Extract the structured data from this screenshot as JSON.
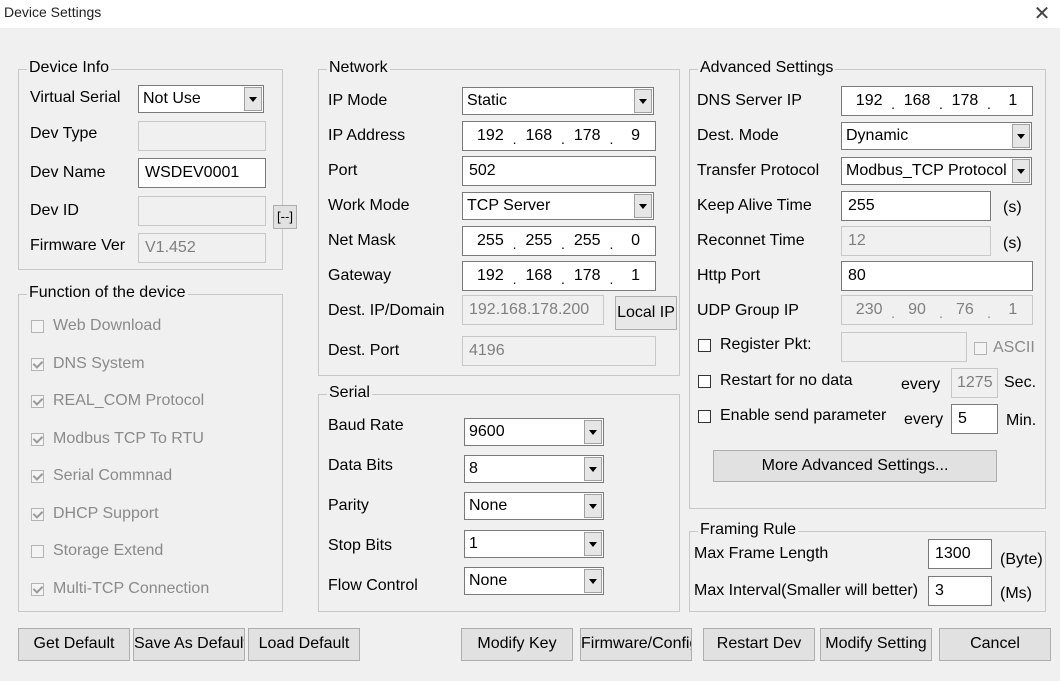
{
  "window": {
    "title": "Device Settings"
  },
  "device_info": {
    "legend": "Device Info",
    "virtual_serial_label": "Virtual Serial",
    "virtual_serial_value": "Not Use",
    "dev_type_label": "Dev Type",
    "dev_type_value": "",
    "dev_name_label": "Dev Name",
    "dev_name_value": "WSDEV0001",
    "dev_id_label": "Dev ID",
    "dev_id_value": "",
    "dev_id_button": "[--]",
    "firmware_label": "Firmware Ver",
    "firmware_value": "V1.452"
  },
  "functions": {
    "legend": "Function of the device",
    "items": [
      {
        "label": "Web Download",
        "checked": false
      },
      {
        "label": "DNS System",
        "checked": true
      },
      {
        "label": "REAL_COM Protocol",
        "checked": true
      },
      {
        "label": "Modbus TCP To RTU",
        "checked": true
      },
      {
        "label": "Serial Commnad",
        "checked": true
      },
      {
        "label": "DHCP Support",
        "checked": true
      },
      {
        "label": "Storage Extend",
        "checked": false
      },
      {
        "label": "Multi-TCP Connection",
        "checked": true
      }
    ]
  },
  "network": {
    "legend": "Network",
    "ip_mode_label": "IP Mode",
    "ip_mode_value": "Static",
    "ip_address_label": "IP Address",
    "ip_address": [
      "192",
      "168",
      "178",
      "9"
    ],
    "port_label": "Port",
    "port_value": "502",
    "work_mode_label": "Work Mode",
    "work_mode_value": "TCP Server",
    "net_mask_label": "Net Mask",
    "net_mask": [
      "255",
      "255",
      "255",
      "0"
    ],
    "gateway_label": "Gateway",
    "gateway": [
      "192",
      "168",
      "178",
      "1"
    ],
    "dest_ip_label": "Dest. IP/Domain",
    "dest_ip_value": "192.168.178.200",
    "local_ip_button": "Local IP",
    "dest_port_label": "Dest. Port",
    "dest_port_value": "4196"
  },
  "serial": {
    "legend": "Serial",
    "baud_rate_label": "Baud Rate",
    "baud_rate_value": "9600",
    "data_bits_label": "Data Bits",
    "data_bits_value": "8",
    "parity_label": "Parity",
    "parity_value": "None",
    "stop_bits_label": "Stop Bits",
    "stop_bits_value": "1",
    "flow_control_label": "Flow Control",
    "flow_control_value": "None"
  },
  "advanced": {
    "legend": "Advanced Settings",
    "dns_label": "DNS Server IP",
    "dns": [
      "192",
      "168",
      "178",
      "1"
    ],
    "dest_mode_label": "Dest. Mode",
    "dest_mode_value": "Dynamic",
    "transfer_label": "Transfer Protocol",
    "transfer_value": "Modbus_TCP Protocol",
    "keep_alive_label": "Keep Alive Time",
    "keep_alive_value": "255",
    "keep_alive_unit": "(s)",
    "reconnect_label": "Reconnet Time",
    "reconnect_value": "12",
    "reconnect_unit": "(s)",
    "http_port_label": "Http Port",
    "http_port_value": "80",
    "udp_group_label": "UDP Group IP",
    "udp_group": [
      "230",
      "90",
      "76",
      "1"
    ],
    "register_label": "Register Pkt:",
    "register_value": "",
    "ascii_label": "ASCII",
    "restart_label": "Restart for no data",
    "restart_every": "every",
    "restart_value": "1275",
    "restart_unit": "Sec.",
    "enable_send_label": "Enable send parameter",
    "enable_send_every": "every",
    "enable_send_value": "5",
    "enable_send_unit": "Min.",
    "more_button": "More Advanced Settings..."
  },
  "framing": {
    "legend": "Framing Rule",
    "max_frame_label": "Max Frame Length",
    "max_frame_value": "1300",
    "max_frame_unit": "(Byte)",
    "max_interval_label": "Max Interval(Smaller will better)",
    "max_interval_value": "3",
    "max_interval_unit": "(Ms)"
  },
  "buttons": {
    "get_default": "Get Default",
    "save_as_default": "Save As Default",
    "load_default": "Load Default",
    "modify_key": "Modify Key",
    "firmware_config": "Firmware/Config",
    "restart_dev": "Restart Dev",
    "modify_setting": "Modify Setting",
    "cancel": "Cancel"
  }
}
